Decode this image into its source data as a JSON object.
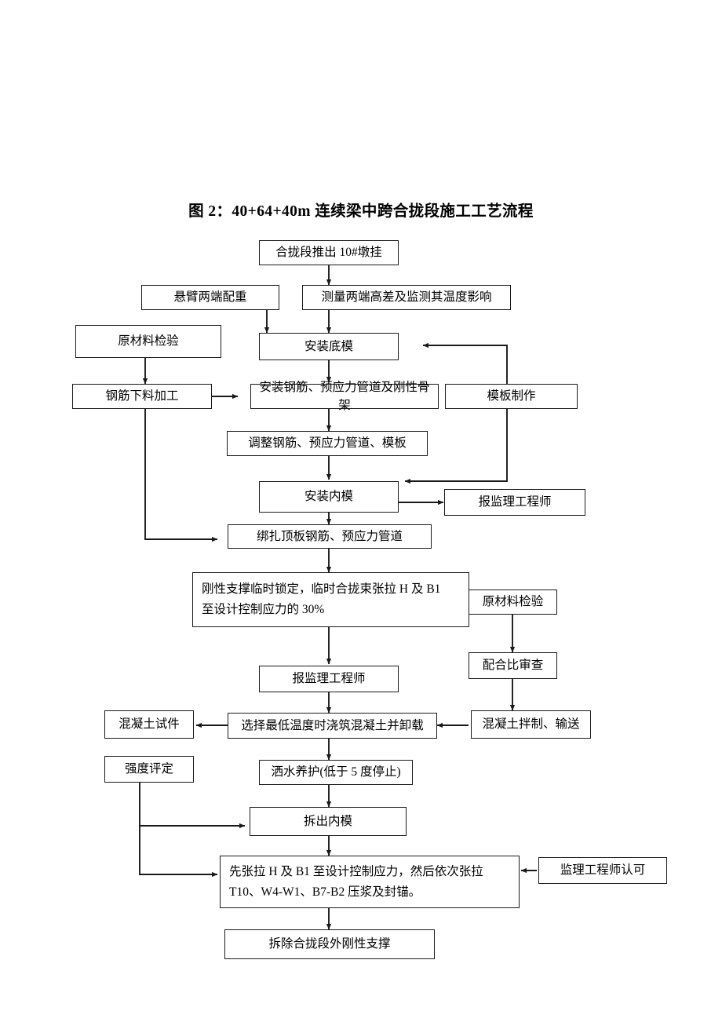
{
  "document": {
    "title": "图 2：40+64+40m 连续梁中跨合拢段施工工艺流程",
    "page_background": "#ffffff",
    "line_color": "#1a1a1a"
  },
  "chart_data": {
    "type": "diagram",
    "title": "图 2：40+64+40m 连续梁中跨合拢段施工工艺流程",
    "subtype": "flowchart",
    "orientation": "top-to-bottom",
    "nodes": [
      {
        "id": "n1",
        "label": "合拢段推出 10#墩挂"
      },
      {
        "id": "n2",
        "label": "悬臂两端配重"
      },
      {
        "id": "n3",
        "label": "测量两端高差及监测其温度影响"
      },
      {
        "id": "n4",
        "label": "原材料检验"
      },
      {
        "id": "n5",
        "label": "安装底模"
      },
      {
        "id": "n6",
        "label": "钢筋下料加工"
      },
      {
        "id": "n7",
        "label": "安装钢筋、预应力管道及刚性骨架"
      },
      {
        "id": "n8",
        "label": "模板制作"
      },
      {
        "id": "n9",
        "label": "调整钢筋、预应力管道、模板"
      },
      {
        "id": "n10",
        "label": "安装内模"
      },
      {
        "id": "n11",
        "label": "报监理工程师"
      },
      {
        "id": "n12",
        "label": "绑扎顶板钢筋、预应力管道"
      },
      {
        "id": "n13",
        "label": "刚性支撑临时锁定，临时合拢束张拉 H 及 B1\n至设计控制应力的 30%"
      },
      {
        "id": "n14",
        "label": "原材料检验"
      },
      {
        "id": "n15",
        "label": "报监理工程师"
      },
      {
        "id": "n16",
        "label": "配合比审查"
      },
      {
        "id": "n17",
        "label": "混凝土试件"
      },
      {
        "id": "n18",
        "label": "选择最低温度时浇筑混凝土并卸载"
      },
      {
        "id": "n19",
        "label": "混凝土拌制、输送"
      },
      {
        "id": "n20",
        "label": "强度评定"
      },
      {
        "id": "n21",
        "label": "洒水养护(低于 5 度停止)"
      },
      {
        "id": "n22",
        "label": "拆出内模"
      },
      {
        "id": "n23",
        "label": "先张拉 H 及 B1 至设计控制应力，然后依次张拉\nT10、W4-W1、B7-B2 压浆及封锚。"
      },
      {
        "id": "n24",
        "label": "监理工程师认可"
      },
      {
        "id": "n25",
        "label": "拆除合拢段外刚性支撑"
      }
    ],
    "edges": [
      {
        "from": "n1",
        "to": "n3"
      },
      {
        "from": "n2",
        "to": "n5"
      },
      {
        "from": "n3",
        "to": "n5"
      },
      {
        "from": "n4",
        "to": "n6"
      },
      {
        "from": "n5",
        "to": "n7"
      },
      {
        "from": "n6",
        "to": "n7"
      },
      {
        "from": "n6",
        "to": "n12"
      },
      {
        "from": "n8",
        "to": "n5"
      },
      {
        "from": "n8",
        "to": "n10"
      },
      {
        "from": "n7",
        "to": "n9"
      },
      {
        "from": "n9",
        "to": "n10"
      },
      {
        "from": "n10",
        "to": "n11"
      },
      {
        "from": "n10",
        "to": "n12"
      },
      {
        "from": "n12",
        "to": "n13"
      },
      {
        "from": "n13",
        "to": "n15"
      },
      {
        "from": "n14",
        "to": "n16"
      },
      {
        "from": "n15",
        "to": "n18"
      },
      {
        "from": "n16",
        "to": "n19"
      },
      {
        "from": "n18",
        "to": "n17"
      },
      {
        "from": "n19",
        "to": "n18"
      },
      {
        "from": "n18",
        "to": "n21"
      },
      {
        "from": "n21",
        "to": "n22"
      },
      {
        "from": "n20",
        "to": "n22"
      },
      {
        "from": "n20",
        "to": "n23"
      },
      {
        "from": "n22",
        "to": "n23"
      },
      {
        "from": "n24",
        "to": "n23"
      },
      {
        "from": "n23",
        "to": "n25"
      }
    ]
  }
}
